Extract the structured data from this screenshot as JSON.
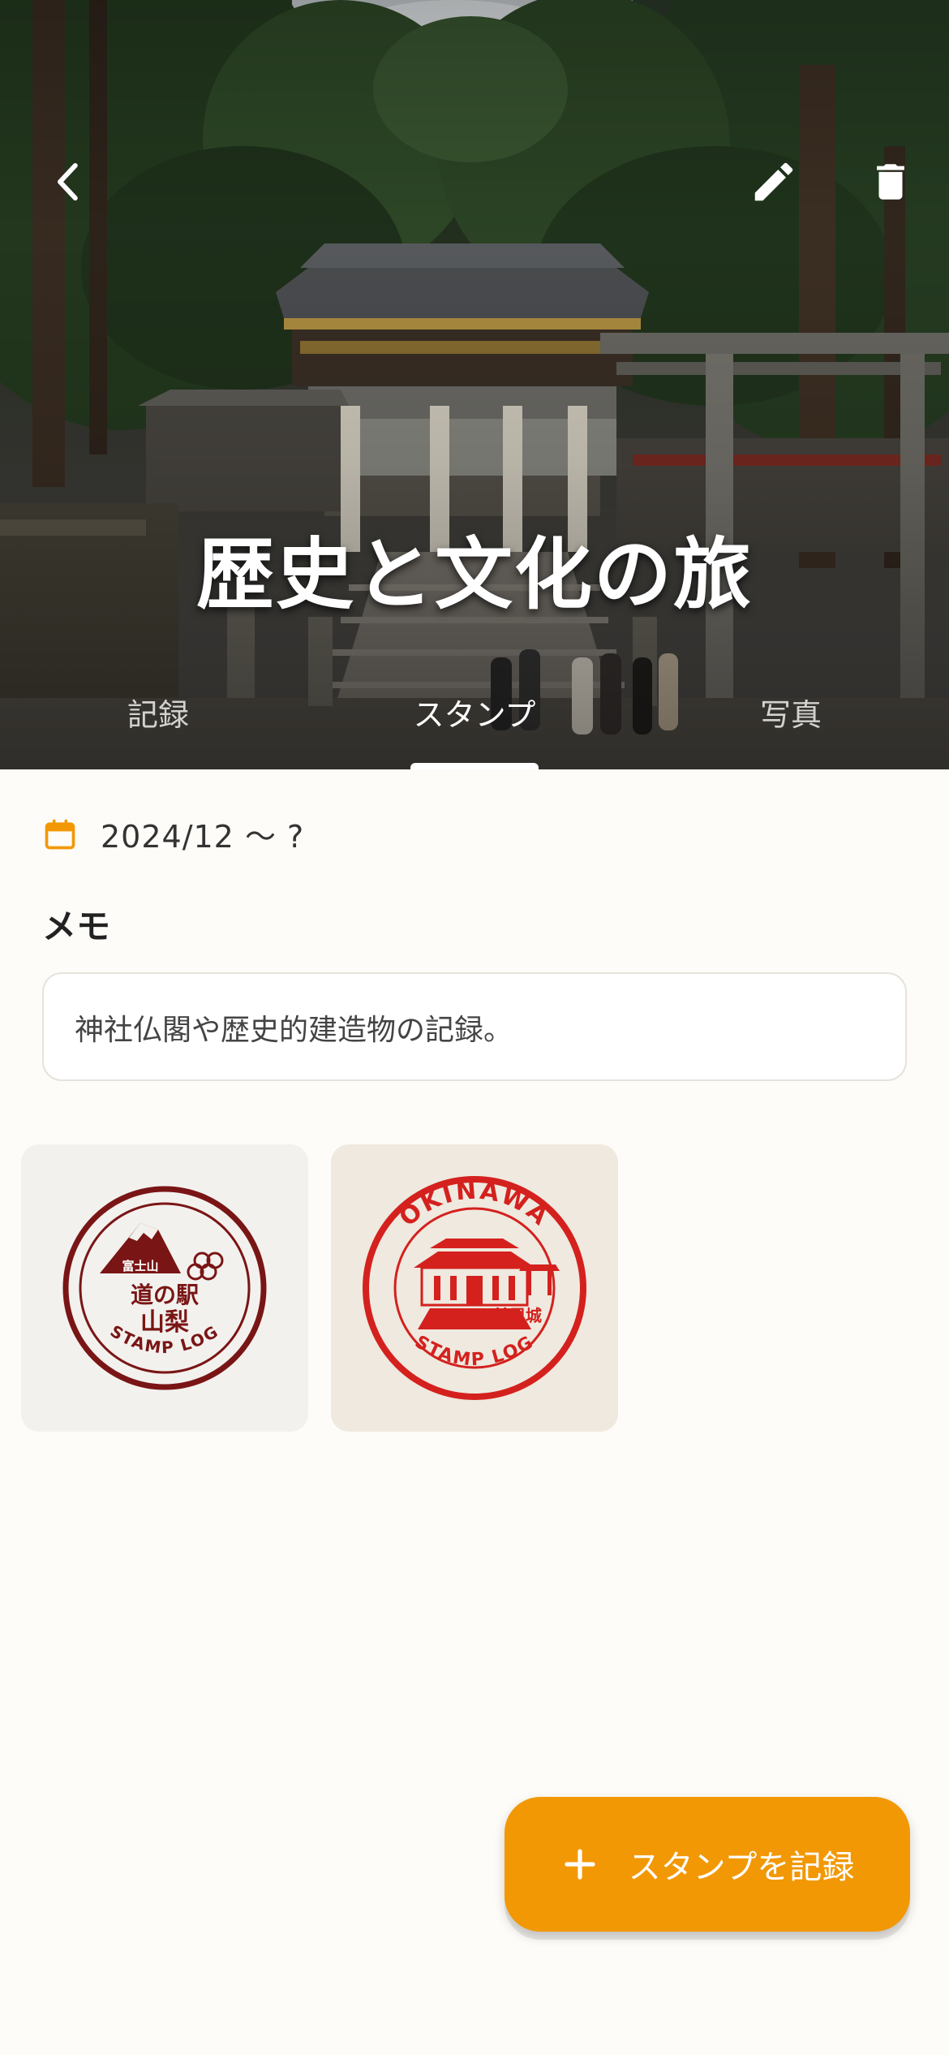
{
  "header": {
    "title": "歴史と文化の旅",
    "back_icon": "chevron-left-icon",
    "edit_icon": "pencil-icon",
    "delete_icon": "trash-icon"
  },
  "tabs": [
    {
      "label": "記録",
      "active": false
    },
    {
      "label": "スタンプ",
      "active": true
    },
    {
      "label": "写真",
      "active": false
    }
  ],
  "date": {
    "icon": "calendar-icon",
    "text": "2024/12 〜 ?"
  },
  "memo": {
    "label": "メモ",
    "text": "神社仏閣や歴史的建造物の記録。"
  },
  "stamps": [
    {
      "top_text": "富士山",
      "line1": "道の駅",
      "line2": "山梨",
      "bottom_text": "STAMP LOG",
      "color": "#7a1515"
    },
    {
      "top_text": "OKINAWA",
      "label": "首里城",
      "bottom_text": "STAMP LOG",
      "color": "#d4211e"
    }
  ],
  "fab": {
    "icon": "plus-icon",
    "label": "スタンプを記録"
  },
  "colors": {
    "accent": "#f29805",
    "background": "#fdfcf8"
  }
}
